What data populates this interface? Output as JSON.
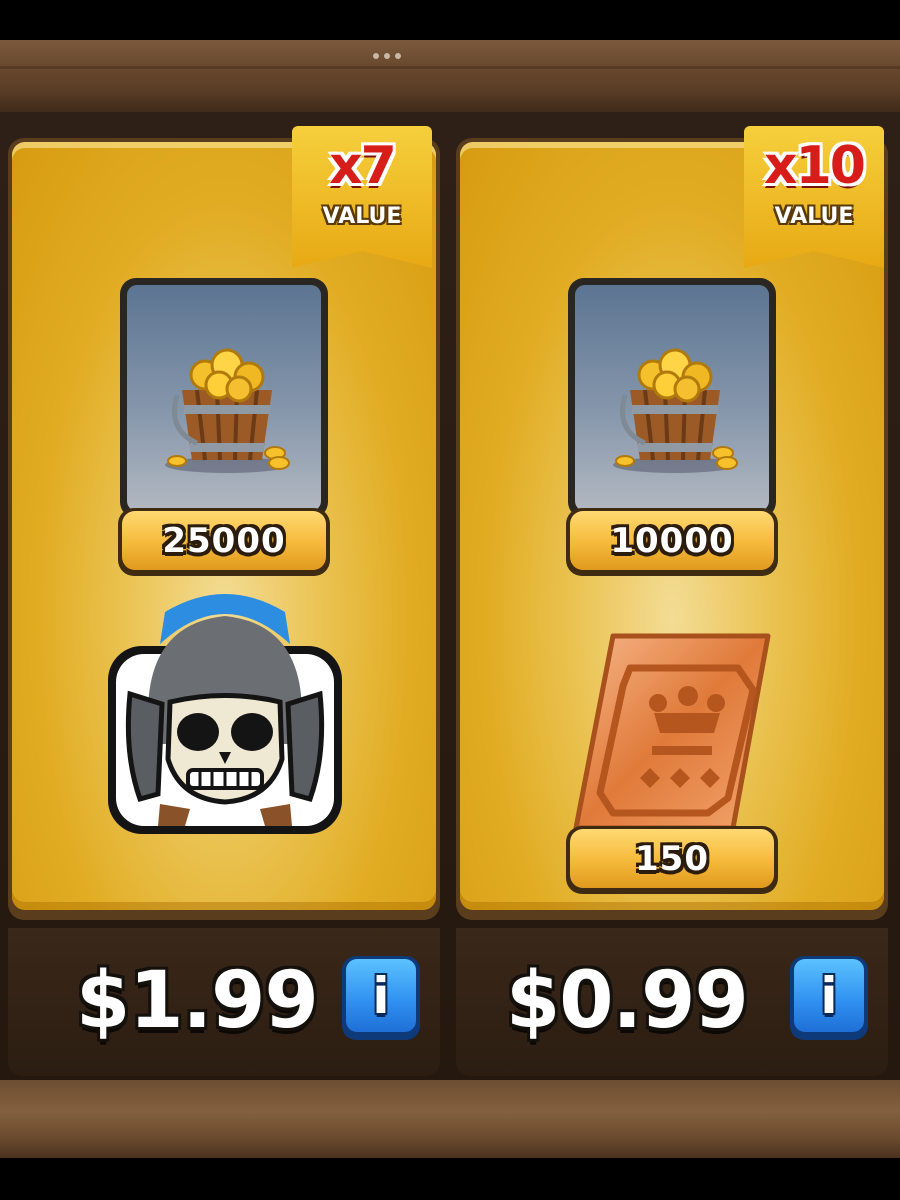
{
  "offers": [
    {
      "value_multiplier": "x7",
      "value_label": "VALUE",
      "gold_amount": "25000",
      "bonus_item": "skeleton-emote",
      "price": "$1.99",
      "info_label": "i"
    },
    {
      "value_multiplier": "x10",
      "value_label": "VALUE",
      "gold_amount": "10000",
      "bonus_item": "wild-card-shard",
      "bonus_amount": "150",
      "price": "$0.99",
      "info_label": "i"
    }
  ],
  "icons": {
    "gold": "gold-bucket-icon",
    "emote": "skeleton-emote-icon",
    "shard": "wild-card-shard-icon",
    "info": "info-icon"
  },
  "colors": {
    "card_gold": "#e1ac22",
    "value_red": "#d71d1a",
    "info_blue": "#2f8ff0",
    "shelf_brown": "#6a4a2f"
  }
}
